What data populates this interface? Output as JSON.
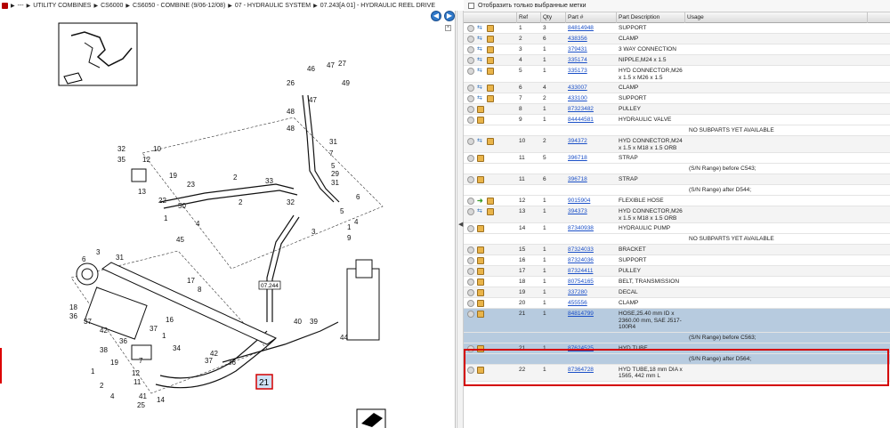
{
  "breadcrumb": {
    "items": [
      "---",
      "UTILITY COMBINES",
      "CS6000",
      "CS6050 - COMBINE (9/06-12/08)",
      "07 - HYDRAULIC SYSTEM",
      "07.243[A 01] - HYDRAULIC REEL DRIVE"
    ]
  },
  "diagram": {
    "callouts": [
      "10",
      "32",
      "35",
      "12",
      "13",
      "22",
      "23",
      "19",
      "2",
      "33",
      "32",
      "6",
      "4",
      "5",
      "48",
      "46",
      "47",
      "27",
      "49",
      "26",
      "47",
      "48",
      "31",
      "7",
      "5",
      "29",
      "31",
      "2",
      "50",
      "1",
      "4",
      "45",
      "3",
      "1",
      "9",
      "6",
      "3",
      "31",
      "17",
      "8",
      "18",
      "36",
      "37",
      "16",
      "37",
      "1",
      "36",
      "42",
      "38",
      "34",
      "42",
      "36",
      "37",
      "7",
      "1",
      "19",
      "12",
      "11",
      "2",
      "4",
      "41",
      "14",
      "25",
      "40",
      "39",
      "44",
      "43",
      "34",
      "20",
      "11",
      "24",
      "21"
    ],
    "label_box": "07.244",
    "selected_callout": "21"
  },
  "filter": {
    "label": "Отобразить только выбранные метки"
  },
  "columns": [
    "",
    "Ref",
    "Qty",
    "Part #",
    "Part Description",
    "Usage"
  ],
  "rows": [
    {
      "ref": "1",
      "qty": "3",
      "part": "84814948",
      "desc": "SUPPORT",
      "usage": "",
      "icons": "full"
    },
    {
      "ref": "2",
      "qty": "6",
      "part": "438356",
      "desc": "CLAMP",
      "usage": "",
      "icons": "full"
    },
    {
      "ref": "3",
      "qty": "1",
      "part": "379431",
      "desc": "3 WAY CONNECTION",
      "usage": "",
      "icons": "full"
    },
    {
      "ref": "4",
      "qty": "1",
      "part": "335174",
      "desc": "NIPPLE,M24 x 1.5",
      "usage": "",
      "icons": "full"
    },
    {
      "ref": "5",
      "qty": "1",
      "part": "335173",
      "desc": "HYD CONNECTOR,M26 x 1.5  x M26 x 1.5",
      "usage": "",
      "icons": "full"
    },
    {
      "ref": "6",
      "qty": "4",
      "part": "433007",
      "desc": "CLAMP",
      "usage": "",
      "icons": "full"
    },
    {
      "ref": "7",
      "qty": "2",
      "part": "433100",
      "desc": "SUPPORT",
      "usage": "",
      "icons": "full"
    },
    {
      "ref": "8",
      "qty": "1",
      "part": "87323482",
      "desc": "PULLEY",
      "usage": "",
      "icons": "box"
    },
    {
      "ref": "9",
      "qty": "1",
      "part": "84444581",
      "desc": "HYDRAULIC VALVE",
      "usage": "",
      "icons": "box",
      "note": "NO SUBPARTS YET AVAILABLE"
    },
    {
      "ref": "10",
      "qty": "2",
      "part": "394372",
      "desc": "HYD CONNECTOR,M24 x 1.5  x M18 x 1.5 ORB",
      "usage": "",
      "icons": "full"
    },
    {
      "ref": "11",
      "qty": "5",
      "part": "396718",
      "desc": "STRAP",
      "usage": "",
      "icons": "box",
      "note": "(S/N Range) before C543;"
    },
    {
      "ref": "11",
      "qty": "6",
      "part": "396718",
      "desc": "STRAP",
      "usage": "",
      "icons": "box",
      "note": "(S/N Range) after D544;"
    },
    {
      "ref": "12",
      "qty": "1",
      "part": "9015904",
      "desc": "FLEXIBLE HOSE",
      "usage": "",
      "icons": "green"
    },
    {
      "ref": "13",
      "qty": "1",
      "part": "394373",
      "desc": "HYD CONNECTOR,M26 x 1.5  x M18 x 1.5 ORB",
      "usage": "",
      "icons": "full"
    },
    {
      "ref": "14",
      "qty": "1",
      "part": "87340938",
      "desc": "HYDRAULIC PUMP",
      "usage": "",
      "icons": "box",
      "note": "NO SUBPARTS YET AVAILABLE"
    },
    {
      "ref": "15",
      "qty": "1",
      "part": "87324033",
      "desc": "BRACKET",
      "usage": "",
      "icons": "box"
    },
    {
      "ref": "16",
      "qty": "1",
      "part": "87324036",
      "desc": "SUPPORT",
      "usage": "",
      "icons": "box"
    },
    {
      "ref": "17",
      "qty": "1",
      "part": "87324411",
      "desc": "PULLEY",
      "usage": "",
      "icons": "box"
    },
    {
      "ref": "18",
      "qty": "1",
      "part": "80754165",
      "desc": "BELT, TRANSMISSION",
      "usage": "",
      "icons": "box"
    },
    {
      "ref": "19",
      "qty": "1",
      "part": "337280",
      "desc": "DECAL",
      "usage": "",
      "icons": "box"
    },
    {
      "ref": "20",
      "qty": "1",
      "part": "455556",
      "desc": "CLAMP",
      "usage": "",
      "icons": "box"
    },
    {
      "ref": "21",
      "qty": "1",
      "part": "84814799",
      "desc": "HOSE,25.40 mm ID x 2360.00 mm, SAE J517-100R4",
      "usage": "",
      "icons": "box",
      "note": "(S/N Range) before C563;",
      "selected": true
    },
    {
      "ref": "21",
      "qty": "1",
      "part": "87624525",
      "desc": "HYD TUBE",
      "usage": "",
      "icons": "box",
      "note": "(S/N Range) after D564;",
      "selected": true
    },
    {
      "ref": "22",
      "qty": "1",
      "part": "87364728",
      "desc": "HYD TUBE,18 mm DIA x 1565, 442 mm L",
      "usage": "",
      "icons": "box"
    }
  ]
}
